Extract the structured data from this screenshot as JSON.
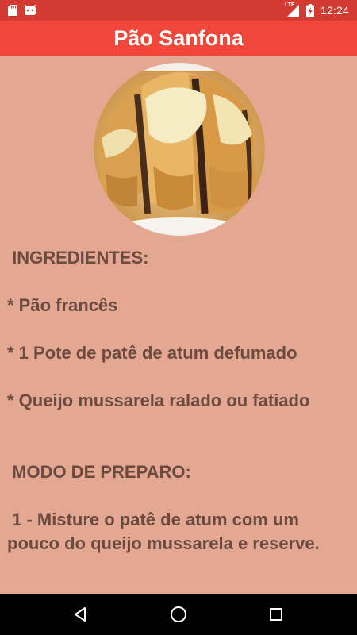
{
  "status_bar": {
    "time": "12:24",
    "network": "LTE",
    "left_icons": [
      "sd-card-icon",
      "android-icon"
    ],
    "right_icons": [
      "signal-icon",
      "battery-charging-icon"
    ]
  },
  "app_bar": {
    "title": "Pão Sanfona",
    "color": "#f1473a"
  },
  "recipe": {
    "image": "pao-sanfona-photo",
    "ingredients_heading": " INGREDIENTES:",
    "ingredients": [
      "* Pão francês",
      "* 1 Pote de patê de atum defumado",
      "* Queijo mussarela ralado ou fatiado"
    ],
    "preparation_heading": " MODO DE PREPARO:",
    "steps": [
      " 1 - Misture o patê de atum com um pouco do queijo mussarela e reserve."
    ]
  },
  "nav_bar": {
    "buttons": [
      "back-icon",
      "home-icon",
      "recents-icon"
    ]
  },
  "colors": {
    "background": "#e3a792",
    "text": "#6b4a3f",
    "status_bar": "#d23a32"
  }
}
